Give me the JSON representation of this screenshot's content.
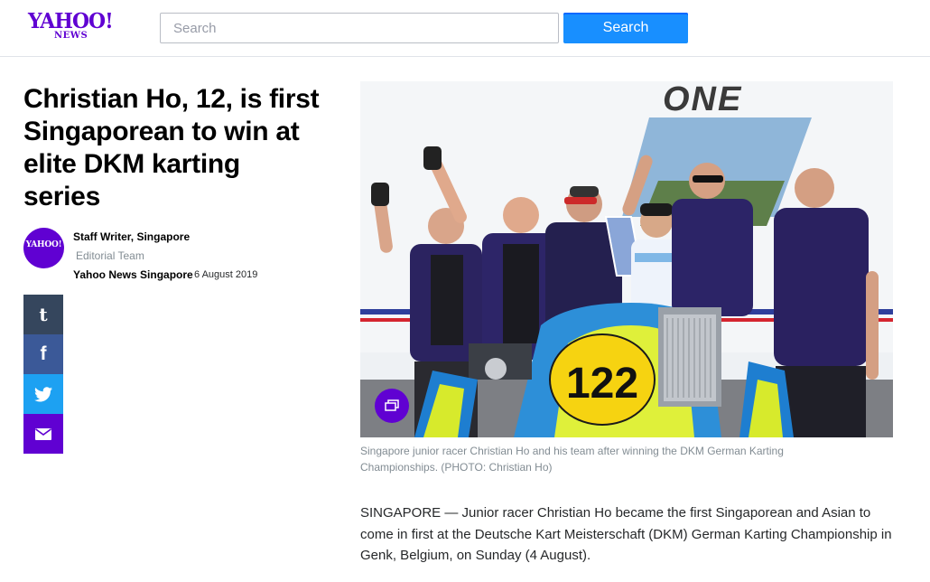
{
  "header": {
    "logo_main": "YAHOO!",
    "logo_sub": "NEWS",
    "search_placeholder": "Search",
    "search_button": "Search"
  },
  "article": {
    "headline": "Christian Ho, 12, is first Singaporean to win at elite DKM karting series",
    "author": {
      "avatar_text": "YAHOO!",
      "name": "Staff Writer, Singapore",
      "team": "Editorial Team",
      "publisher": "Yahoo News Singapore",
      "date": "6 August 2019"
    },
    "share": {
      "tumblr": "t",
      "facebook": "f",
      "twitter_icon": "twitter-icon",
      "mail_icon": "mail-icon"
    },
    "photo": {
      "brand_text": "ONE",
      "kart_number": "122",
      "caption": "Singapore junior racer Christian Ho and his team after winning the DKM German Karting Championships. (PHOTO: Christian Ho)"
    },
    "body": "SINGAPORE — Junior racer Christian Ho became the first Singaporean and Asian to come in first at the Deutsche Kart Meisterschaft (DKM) German Karting Championship in Genk, Belgium, on Sunday (4 August)."
  },
  "colors": {
    "brand_purple": "#6001d2",
    "search_blue": "#188fff",
    "tumblr": "#35465d",
    "facebook": "#3b5998",
    "twitter": "#1da1f2"
  }
}
